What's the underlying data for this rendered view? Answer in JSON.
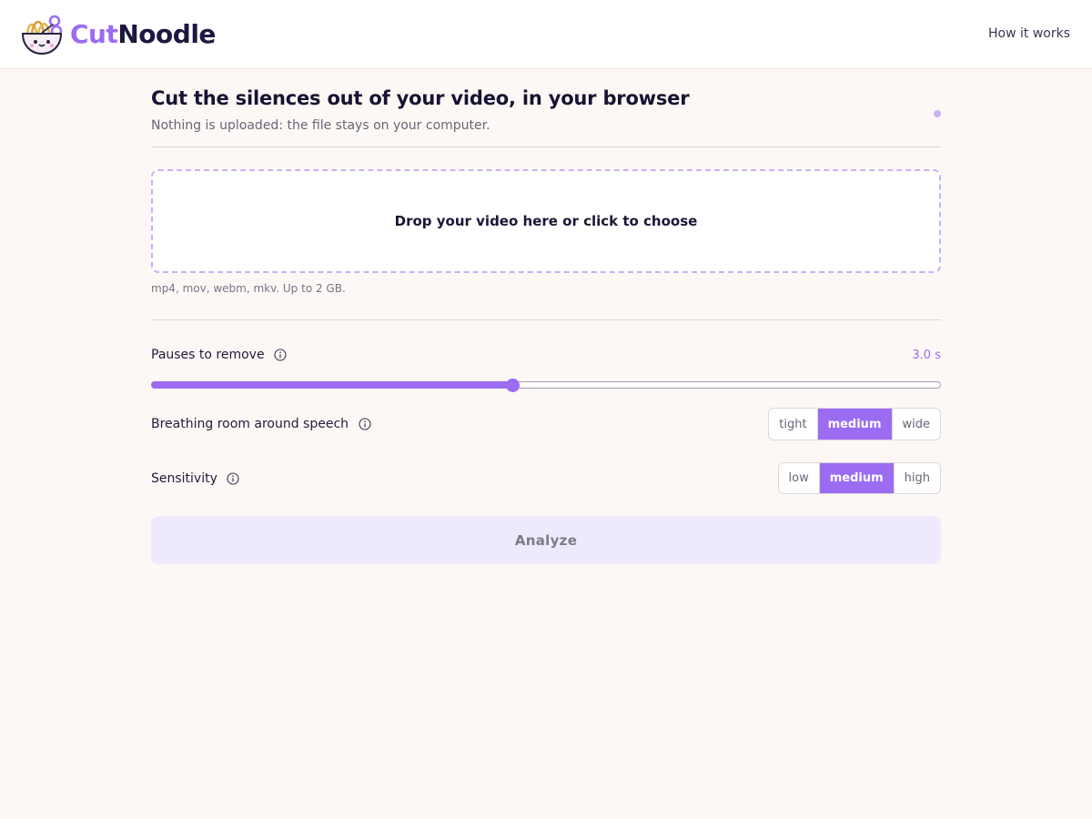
{
  "header": {
    "logo_part1": "Cut",
    "logo_part2": "Noodle",
    "nav_link": "How it works"
  },
  "intro": {
    "title": "Cut the silences out of your video, in your browser",
    "subtitle": "Nothing is uploaded: the file stays on your computer."
  },
  "upload": {
    "dropzone_label": "Drop your video here or click to choose",
    "formats_hint": "mp4, mov, webm, mkv. Up to 2 GB."
  },
  "settings": {
    "pauses": {
      "label": "Pauses to remove",
      "value_text": "3.0 s",
      "slider_fraction": 0.457
    },
    "breathing": {
      "label": "Breathing room around speech",
      "options": [
        "tight",
        "medium",
        "wide"
      ],
      "selected": "medium"
    },
    "sensitivity": {
      "label": "Sensitivity",
      "options": [
        "low",
        "medium",
        "high"
      ],
      "selected": "medium"
    }
  },
  "actions": {
    "analyze_label": "Analyze"
  },
  "icons": {
    "logo": "noodle-bowl-scissors-icon",
    "info": "info-circle-icon"
  },
  "colors": {
    "accent": "#9b6cf2",
    "background": "#fdf8f5",
    "text": "#1c1840"
  }
}
